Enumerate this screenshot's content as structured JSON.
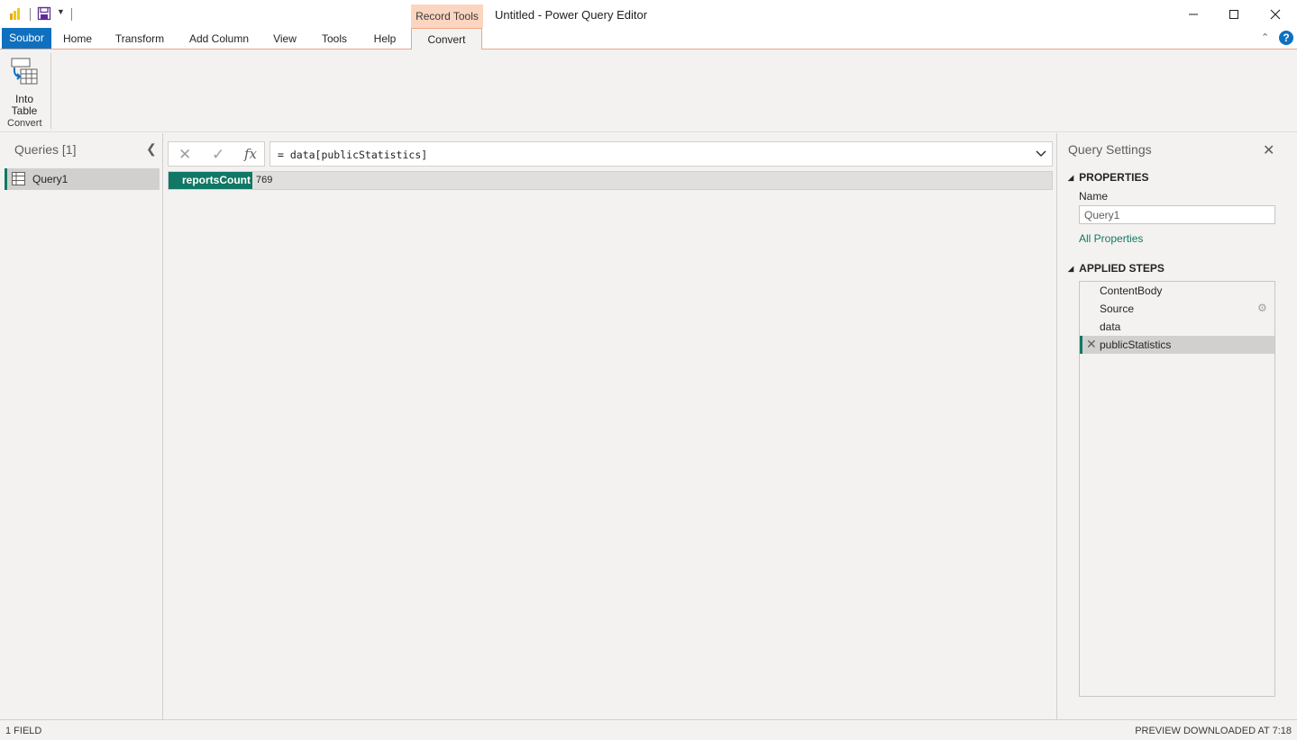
{
  "window": {
    "title": "Untitled - Power Query Editor",
    "context_group": "Record Tools"
  },
  "ribbon": {
    "tabs": [
      "Soubor",
      "Home",
      "Transform",
      "Add Column",
      "View",
      "Tools",
      "Help",
      "Convert"
    ],
    "active_tab": "Convert",
    "buttons": {
      "into_table_line1": "Into",
      "into_table_line2": "Table"
    },
    "group_label": "Convert"
  },
  "queries": {
    "title": "Queries [1]",
    "items": [
      {
        "label": "Query1"
      }
    ]
  },
  "formula": {
    "text": "= data[publicStatistics]",
    "fx": "fx"
  },
  "record": {
    "field": "reportsCount",
    "value": "769"
  },
  "settings": {
    "title": "Query Settings",
    "properties_header": "PROPERTIES",
    "name_label": "Name",
    "name_value": "Query1",
    "all_properties": "All Properties",
    "steps_header": "APPLIED STEPS",
    "steps": [
      {
        "label": "ContentBody"
      },
      {
        "label": "Source"
      },
      {
        "label": "data"
      },
      {
        "label": "publicStatistics"
      }
    ]
  },
  "status": {
    "left": "1 FIELD",
    "right": "PREVIEW DOWNLOADED AT 7:18"
  },
  "colors": {
    "accent_green": "#117865",
    "file_tab_blue": "#1070c0",
    "context_orange": "#fbd5c0",
    "logo_yellow": "#f2c811"
  }
}
